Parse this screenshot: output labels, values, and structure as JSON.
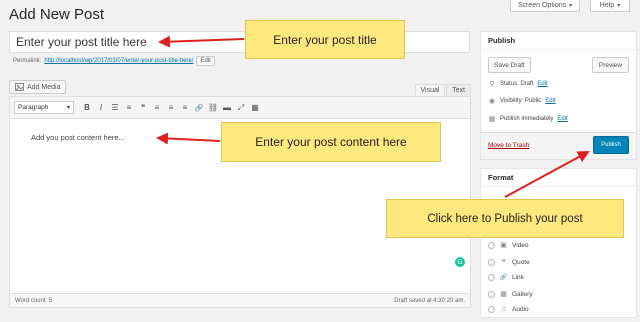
{
  "screen_options": {
    "screen_options_label": "Screen Options",
    "help_label": "Help",
    "caret": "▾"
  },
  "page": {
    "title": "Add New Post"
  },
  "title_field": {
    "value": "Enter your post title here"
  },
  "permalink": {
    "label": "Permalink:",
    "url": "http://localhost/wp/2017/03/07/enter-your-post-title-here/",
    "edit_label": "Edit"
  },
  "media": {
    "add_media_label": "Add Media",
    "icon": "media-icon"
  },
  "editor": {
    "tab_visual": "Visual",
    "tab_text": "Text",
    "format_select": "Paragraph",
    "toolbar_icons": [
      "bold-icon",
      "italic-icon",
      "bulleted-list-icon",
      "numbered-list-icon",
      "blockquote-icon",
      "align-left-icon",
      "align-center-icon",
      "align-right-icon",
      "link-icon",
      "unlink-icon",
      "read-more-icon",
      "fullscreen-icon",
      "toolbar-toggle-icon"
    ],
    "toolbar_glyphs": [
      "B",
      "I",
      "☰",
      "≡",
      "❝",
      "≡",
      "≡",
      "≡",
      "🔗",
      "⛓",
      "▬",
      "⤢",
      "▦"
    ],
    "content": "Add you post content here...",
    "word_count": "Word count: 5",
    "draft_saved": "Draft saved at 4:30:20 am."
  },
  "publish_box": {
    "title": "Publish",
    "save_draft": "Save Draft",
    "preview": "Preview",
    "status_label": "Status: Draft",
    "visibility_label": "Visibility: Public",
    "schedule_label": "Publish immediately",
    "edit_label": "Edit",
    "trash_label": "Move to Trash",
    "publish_label": "Publish"
  },
  "format_box": {
    "title": "Format",
    "options": [
      {
        "label": "Video",
        "icon": "video-icon",
        "glyph": "▣"
      },
      {
        "label": "Quote",
        "icon": "quote-icon",
        "glyph": "❝"
      },
      {
        "label": "Link",
        "icon": "link-icon",
        "glyph": "🔗"
      },
      {
        "label": "Gallery",
        "icon": "gallery-icon",
        "glyph": "▦"
      },
      {
        "label": "Audio",
        "icon": "audio-icon",
        "glyph": "♫"
      }
    ]
  },
  "callouts": {
    "title": "Enter your post title",
    "content": "Enter your post content here",
    "publish": "Click here to Publish your post"
  },
  "colors": {
    "annotation_arrow": "#e02020",
    "callout_fill": "#ffe97f",
    "publish_button": "#0085ba",
    "link": "#0073aa",
    "trash": "#aa0000"
  }
}
